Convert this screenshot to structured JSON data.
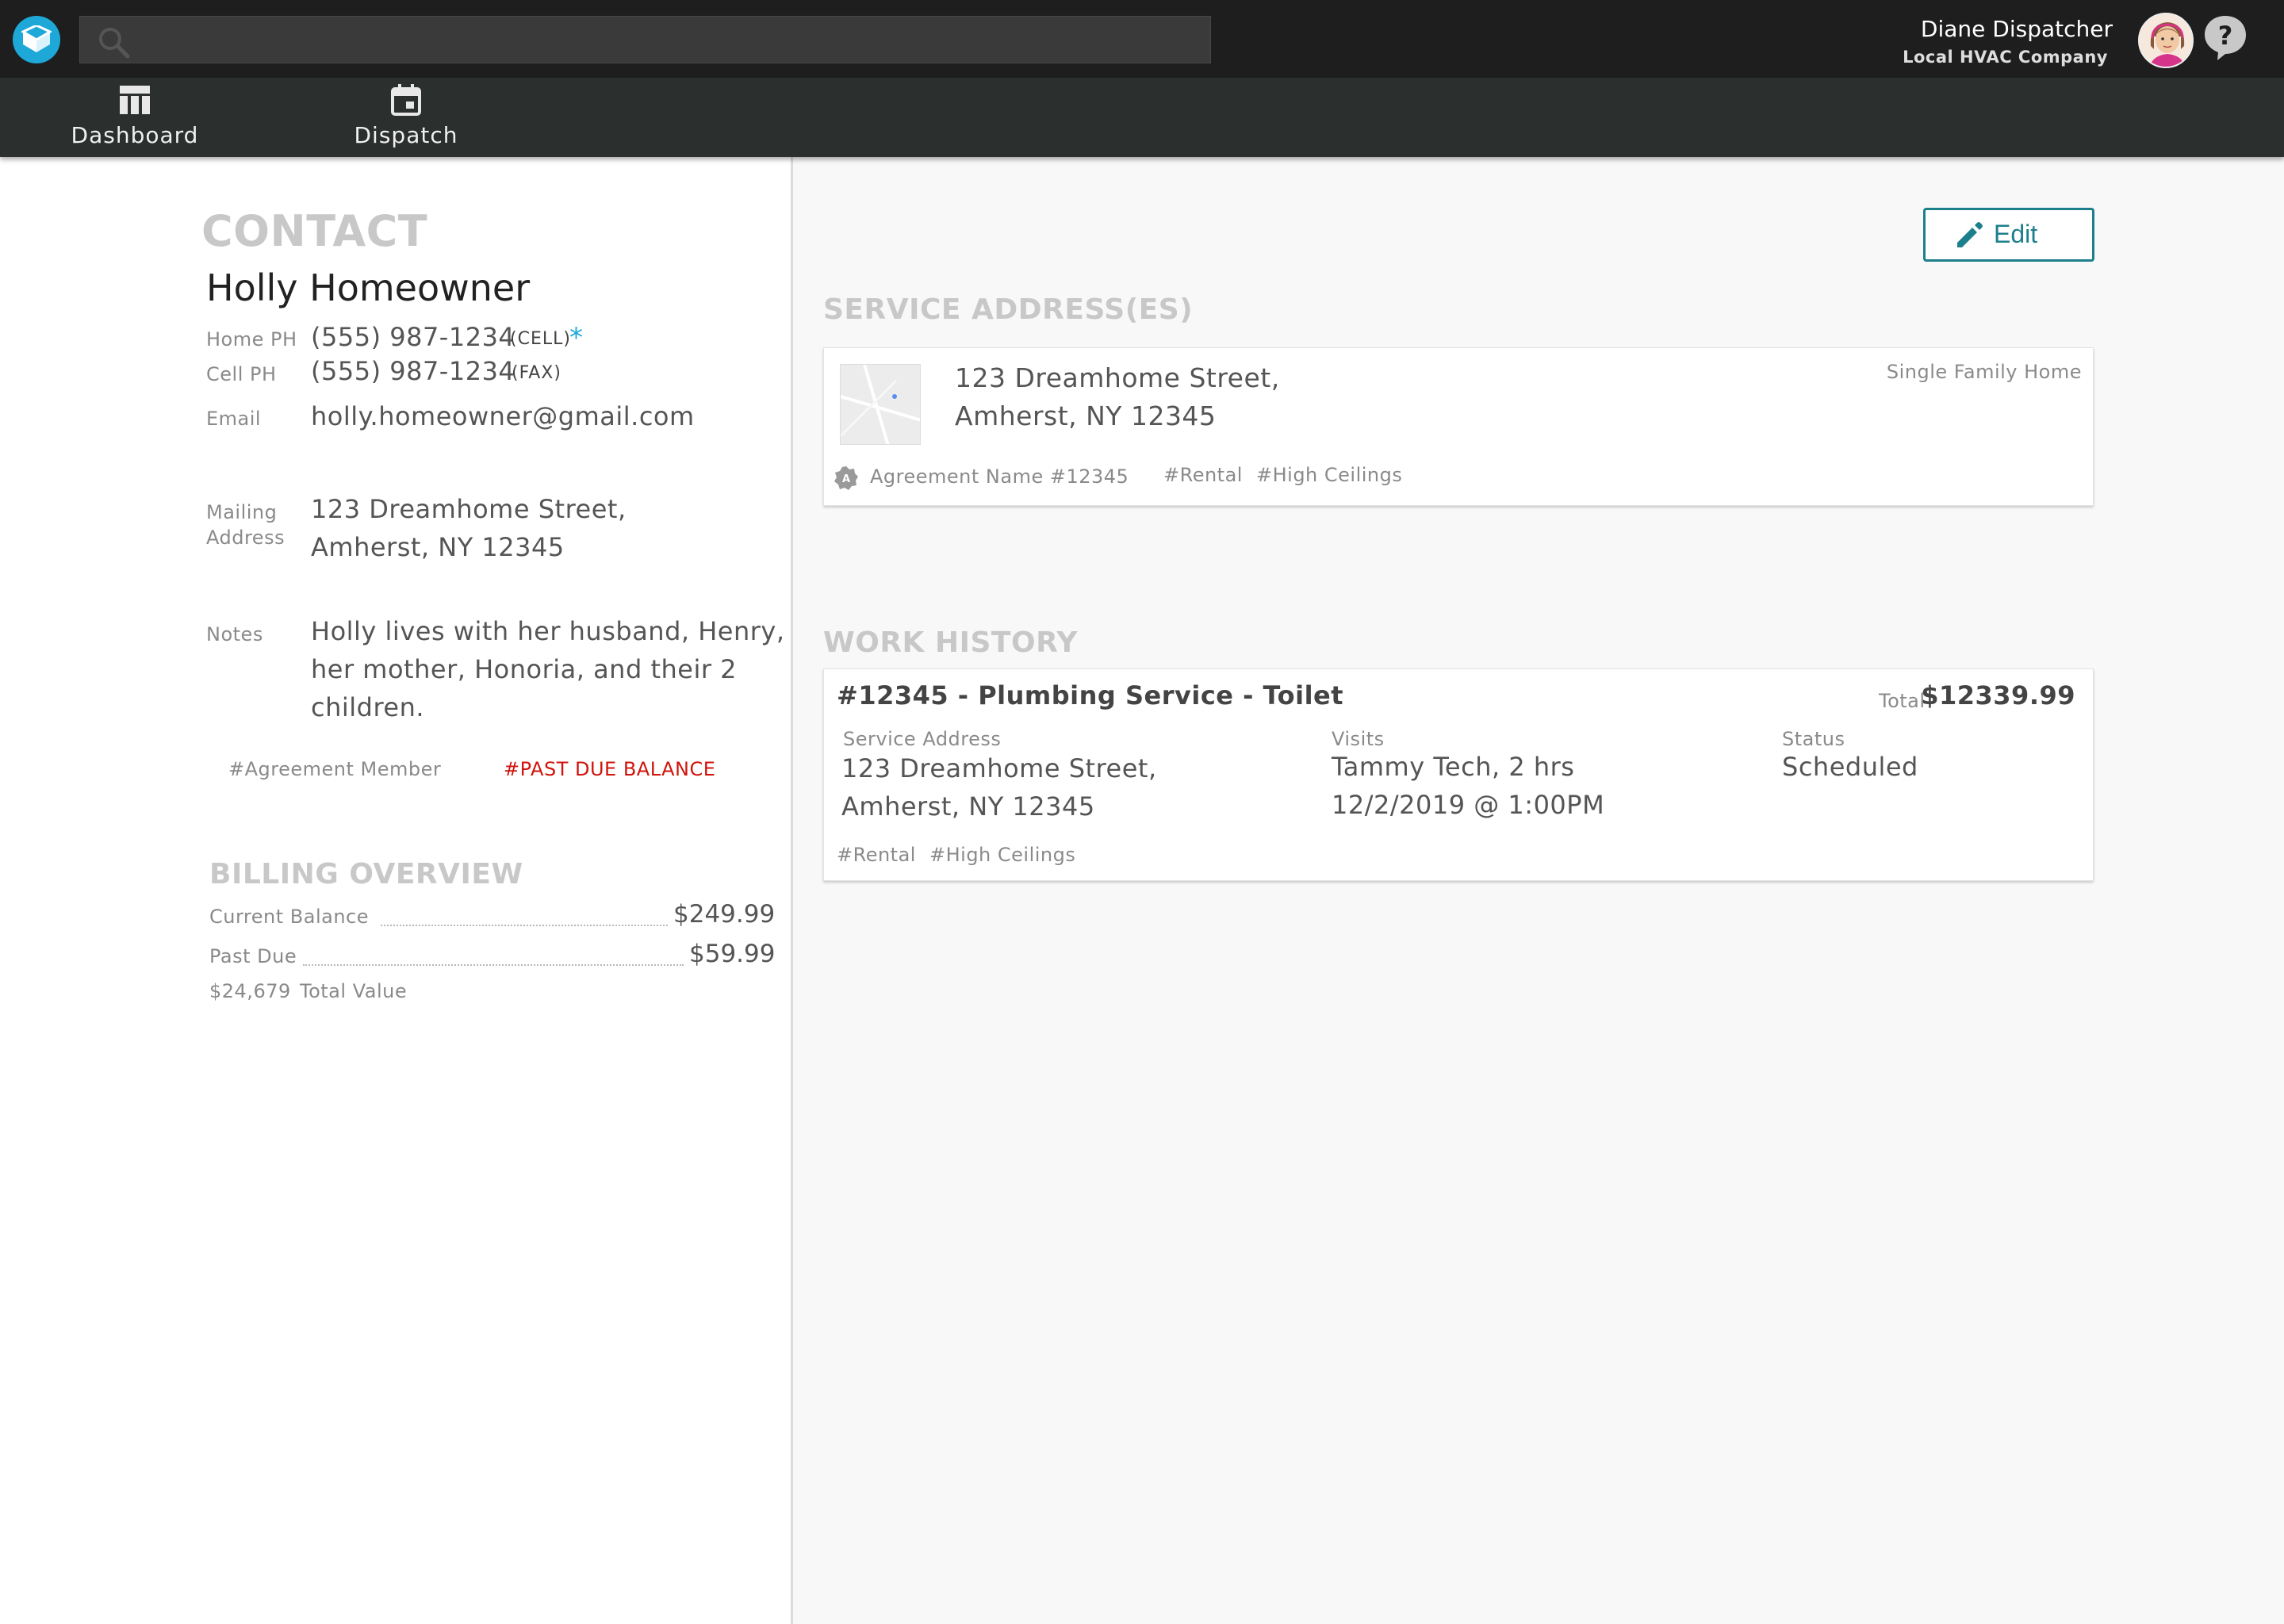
{
  "header": {
    "user_name": "Diane Dispatcher",
    "company": "Local HVAC Company"
  },
  "nav": [
    {
      "label": "Dashboard",
      "icon": "dashboard-icon"
    },
    {
      "label": "Dispatch",
      "icon": "calendar-icon"
    }
  ],
  "contact": {
    "heading": "CONTACT",
    "name": "Holly Homeowner",
    "phones": [
      {
        "label": "Home PH",
        "number": "(555) 987-1234",
        "type": "(CELL)",
        "primary_mark": "*"
      },
      {
        "label": "Cell PH",
        "number": "(555) 987-1234",
        "type": "(FAX)"
      }
    ],
    "email_label": "Email",
    "email": "holly.homeowner@gmail.com",
    "mailing_label_1": "Mailing",
    "mailing_label_2": "Address",
    "mailing_line1": "123 Dreamhome Street,",
    "mailing_line2": "Amherst, NY 12345",
    "notes_label": "Notes",
    "notes_lines": [
      "Holly lives with her husband, Henry,",
      "her mother, Honoria, and their 2",
      "children."
    ],
    "tags": [
      "#Agreement Member",
      "#PAST DUE BALANCE"
    ]
  },
  "billing": {
    "heading": "BILLING OVERVIEW",
    "current_balance_label": "Current Balance",
    "current_balance": "$249.99",
    "past_due_label": "Past Due",
    "past_due": "$59.99",
    "total_value_amount": "$24,679",
    "total_value_label": "Total Value"
  },
  "edit_label": "Edit",
  "service_addresses": {
    "heading": "SERVICE ADDRESS(ES)",
    "items": [
      {
        "line1": "123 Dreamhome Street,",
        "line2": "Amherst, NY 12345",
        "type": "Single Family Home",
        "agreement": "Agreement Name #12345",
        "agreement_badge": "A",
        "tags": [
          "#Rental",
          "#High Ceilings"
        ]
      }
    ]
  },
  "work_history": {
    "heading": "WORK HISTORY",
    "items": [
      {
        "title": "#12345 - Plumbing Service - Toilet",
        "total_label": "Total",
        "total": "$12339.99",
        "service_address_label": "Service Address",
        "address_line1": "123 Dreamhome Street,",
        "address_line2": "Amherst, NY 12345",
        "visits_label": "Visits",
        "visit_tech": "Tammy Tech, 2 hrs",
        "visit_time": "12/2/2019 @ 1:00PM",
        "status_label": "Status",
        "status": "Scheduled",
        "tags": [
          "#Rental",
          "#High Ceilings"
        ]
      }
    ]
  },
  "colors": {
    "topbar": "#1e1e1e",
    "navbar": "#2b2f2e",
    "accent": "#1d7f8c",
    "logo": "#1ea8d8",
    "alert": "#d0140c",
    "primary_mark": "#1ea8d8"
  }
}
